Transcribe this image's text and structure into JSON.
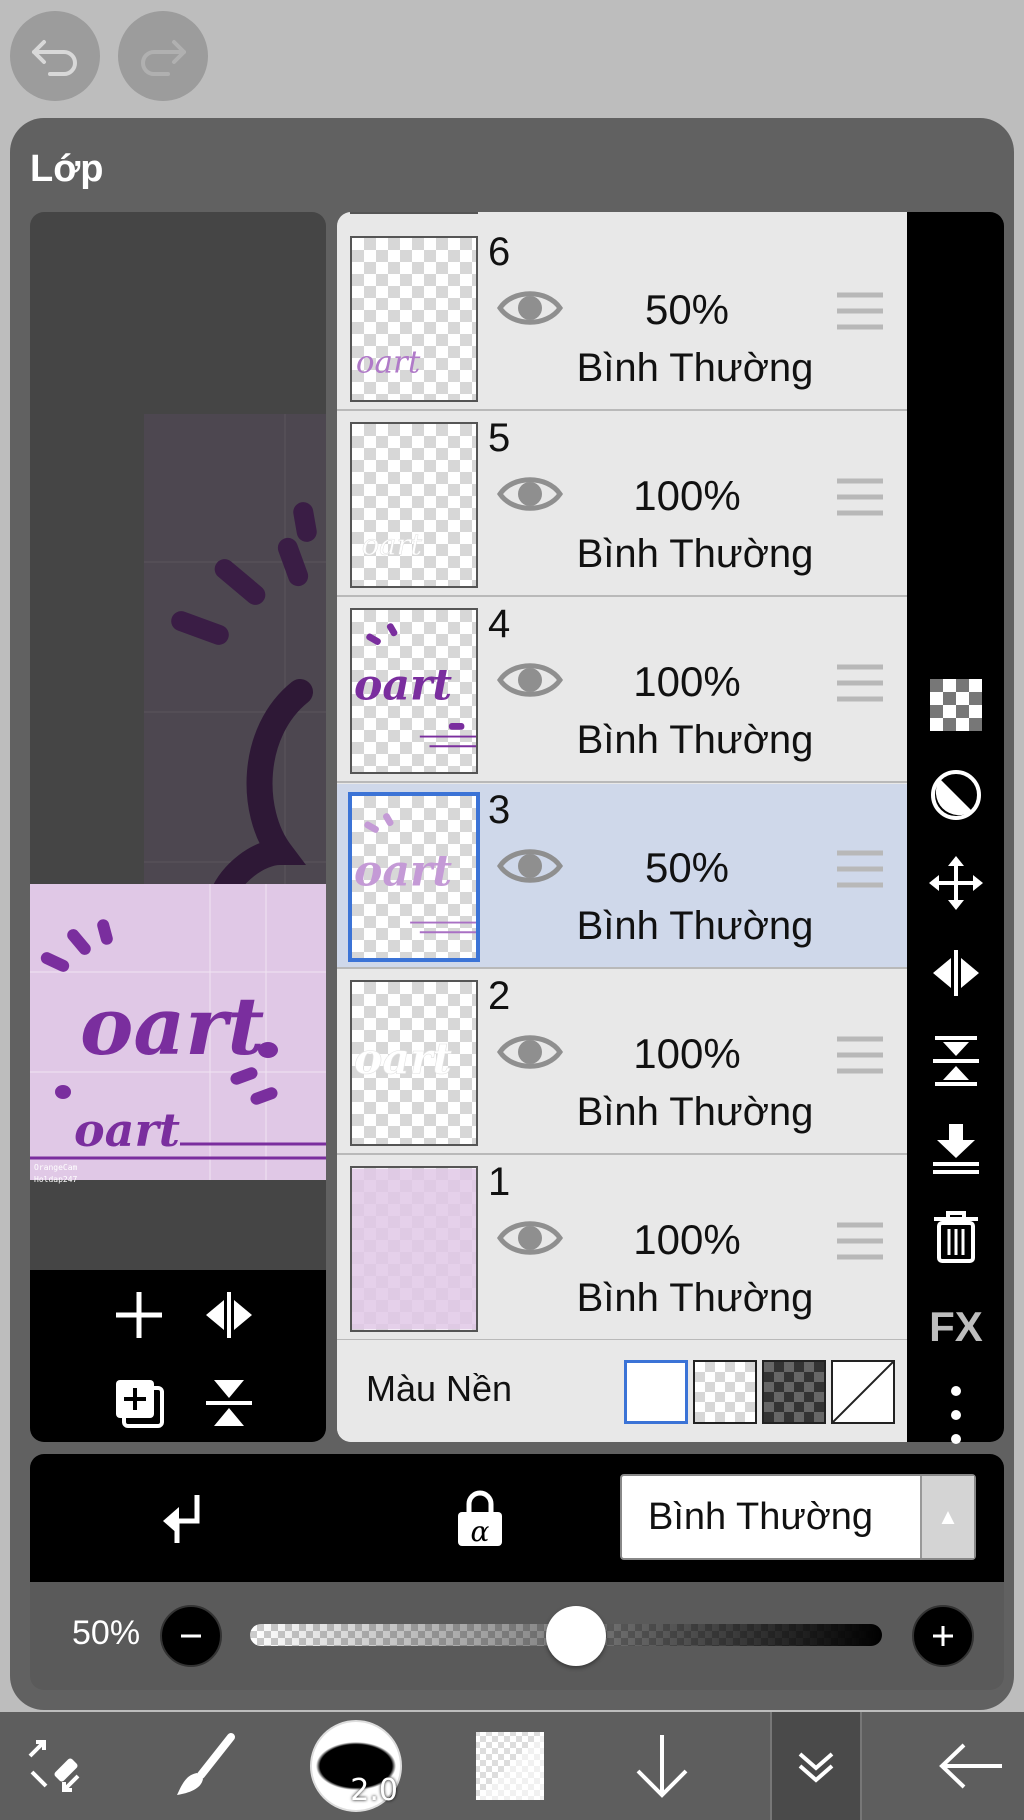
{
  "panel": {
    "title": "Lớp"
  },
  "layers": [
    {
      "number": "6",
      "opacity": "50%",
      "blend": "Bình Thường",
      "selected": false
    },
    {
      "number": "5",
      "opacity": "100%",
      "blend": "Bình Thường",
      "selected": false
    },
    {
      "number": "4",
      "opacity": "100%",
      "blend": "Bình Thường",
      "selected": false
    },
    {
      "number": "3",
      "opacity": "50%",
      "blend": "Bình Thường",
      "selected": true
    },
    {
      "number": "2",
      "opacity": "100%",
      "blend": "Bình Thường",
      "selected": false
    },
    {
      "number": "1",
      "opacity": "100%",
      "blend": "Bình Thường",
      "selected": false
    }
  ],
  "background": {
    "label": "Màu Nền"
  },
  "controls": {
    "blend_mode": "Bình Thường",
    "blend_arrow": "▲"
  },
  "opacity_slider": {
    "label": "50%",
    "value": 0.5
  },
  "right_tools": {
    "fx_label": "FX"
  },
  "toolbar": {
    "brush_size": "2.0"
  },
  "preview": {
    "watermark_line1": "OrangeCam",
    "watermark_line2": "Holdap247"
  },
  "colors": {
    "accent": "#3b73d6",
    "selected_row": "#cfd8ea",
    "art_purple": "#7a2e9e",
    "art_bg": "#e0c8e6"
  }
}
